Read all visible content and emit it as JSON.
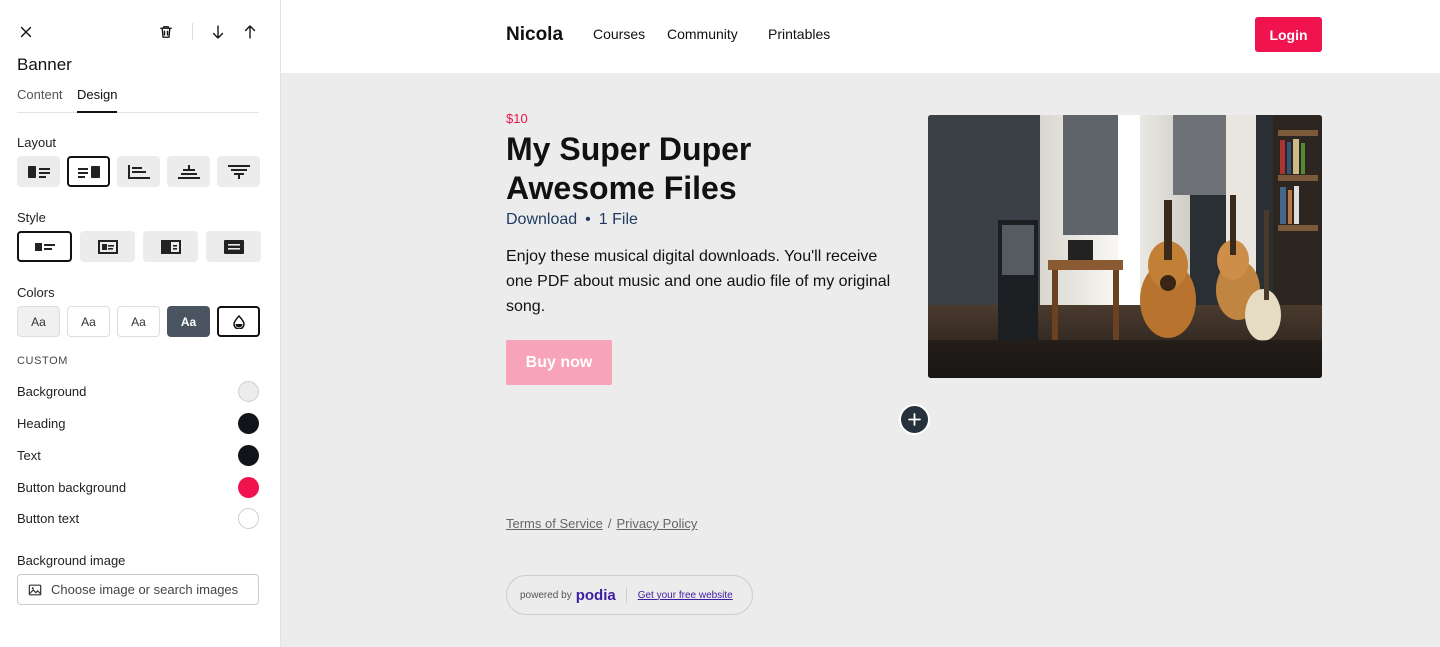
{
  "panel": {
    "title": "Banner",
    "tabs": [
      "Content",
      "Design"
    ],
    "active_tab": "Design",
    "layout_label": "Layout",
    "style_label": "Style",
    "colors_label": "Colors",
    "color_option_text": "Aa",
    "custom_label": "CUSTOM",
    "custom_colors": [
      {
        "label": "Background",
        "color": "#ececec"
      },
      {
        "label": "Heading",
        "color": "#111418"
      },
      {
        "label": "Text",
        "color": "#111418"
      },
      {
        "label": "Button background",
        "color": "#f0134d"
      },
      {
        "label": "Button text",
        "color": "#ffffff"
      }
    ],
    "bg_image_label": "Background image",
    "bg_image_placeholder": "Choose image or search images"
  },
  "site": {
    "brand": "Nicola",
    "nav": [
      "Courses",
      "Community",
      "Printables"
    ],
    "login": "Login"
  },
  "banner": {
    "price": "$10",
    "headline": "My Super Duper Awesome Files",
    "type": "Download",
    "separator": "•",
    "file_count": "1 File",
    "description": "Enjoy these musical digital downloads. You'll receive one PDF about music and one audio file of my original song.",
    "button": "Buy now"
  },
  "footer": {
    "terms": "Terms of Service",
    "slash": "/",
    "privacy": "Privacy Policy",
    "powered_by": "powered by",
    "podia": "podia",
    "free_site": "Get your free website"
  },
  "colors": {
    "accent": "#f0134d",
    "button_faded": "#f7a3b8",
    "dark": "#26313b"
  }
}
